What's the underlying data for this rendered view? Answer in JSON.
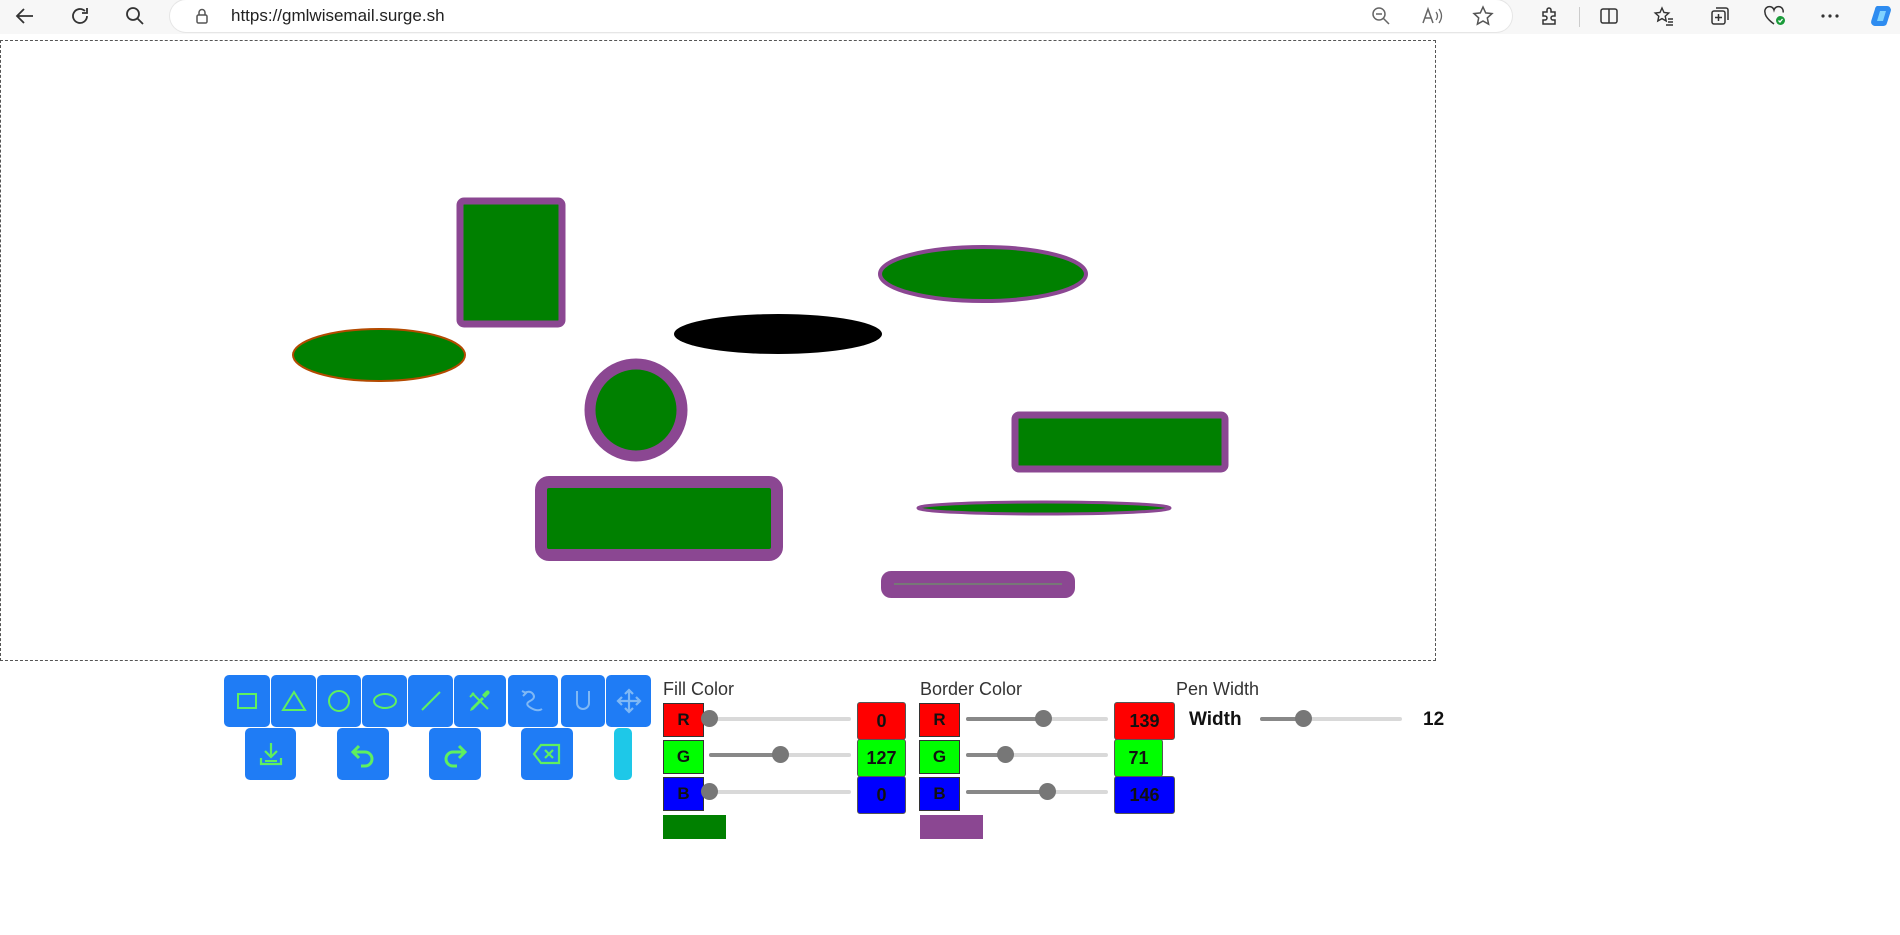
{
  "browser": {
    "url": "https://gmlwisemail.surge.sh",
    "icons": [
      "back-icon",
      "refresh-icon",
      "search-icon",
      "lock-icon",
      "zoom-out-icon",
      "read-aloud-icon",
      "favorite-star-icon",
      "extensions-icon",
      "split-screen-icon",
      "favorites-icon",
      "collections-icon",
      "browser-essentials-icon",
      "more-icon",
      "copilot-icon"
    ]
  },
  "canvas": {
    "shapes": [
      {
        "type": "rect",
        "name": "shape-rectangle-tall",
        "fill": "#008000",
        "stroke": "#8b4792"
      },
      {
        "type": "ellipse",
        "name": "shape-ellipse-left",
        "fill": "#008000",
        "stroke": "#b34a00"
      },
      {
        "type": "ellipse",
        "name": "shape-ellipse-black",
        "fill": "#000000",
        "stroke": "#000000"
      },
      {
        "type": "ellipse",
        "name": "shape-ellipse-top-right",
        "fill": "#008000",
        "stroke": "#8b4792"
      },
      {
        "type": "circle",
        "name": "shape-circle",
        "fill": "#008000",
        "stroke": "#8b4792"
      },
      {
        "type": "rect",
        "name": "shape-rectangle-right",
        "fill": "#008000",
        "stroke": "#8b4792"
      },
      {
        "type": "rect",
        "name": "shape-rectangle-bottom",
        "fill": "#008000",
        "stroke": "#8b4792"
      },
      {
        "type": "ellipse",
        "name": "shape-ellipse-thin",
        "fill": "#008000",
        "stroke": "#8b4792"
      },
      {
        "type": "line",
        "name": "shape-line",
        "fill": "#888888",
        "stroke": "#8b4792"
      }
    ]
  },
  "tools": {
    "row1": [
      "rectangle-tool-icon",
      "triangle-tool-icon",
      "circle-tool-icon",
      "ellipse-tool-icon",
      "line-tool-icon",
      "eyedropper-tool-icon",
      "freehand-tool-icon",
      "union-tool-icon",
      "move-tool-icon"
    ],
    "row2": [
      "download-icon",
      "undo-icon",
      "redo-icon",
      "delete-icon",
      "color-indicator"
    ],
    "accent": "#1f7cf5",
    "icon_color": "#5ff05f"
  },
  "fill": {
    "title": "Fill Color",
    "channels": [
      {
        "label": "R",
        "value": "0",
        "color": "#ff0000",
        "level": 0
      },
      {
        "label": "G",
        "value": "127",
        "color": "#00ff00",
        "level": 0.498
      },
      {
        "label": "B",
        "value": "0",
        "color": "#0000ff",
        "level": 0
      }
    ],
    "swatch": "#008000"
  },
  "border": {
    "title": "Border Color",
    "channels": [
      {
        "label": "R",
        "value": "139",
        "color": "#ff0000",
        "level": 0.545
      },
      {
        "label": "G",
        "value": "71",
        "color": "#00ff00",
        "level": 0.278
      },
      {
        "label": "B",
        "value": "146",
        "color": "#0000ff",
        "level": 0.573
      }
    ],
    "swatch": "#8b4792"
  },
  "pen": {
    "title": "Pen Width",
    "label": "Width",
    "value": "12",
    "level": 0.3
  }
}
